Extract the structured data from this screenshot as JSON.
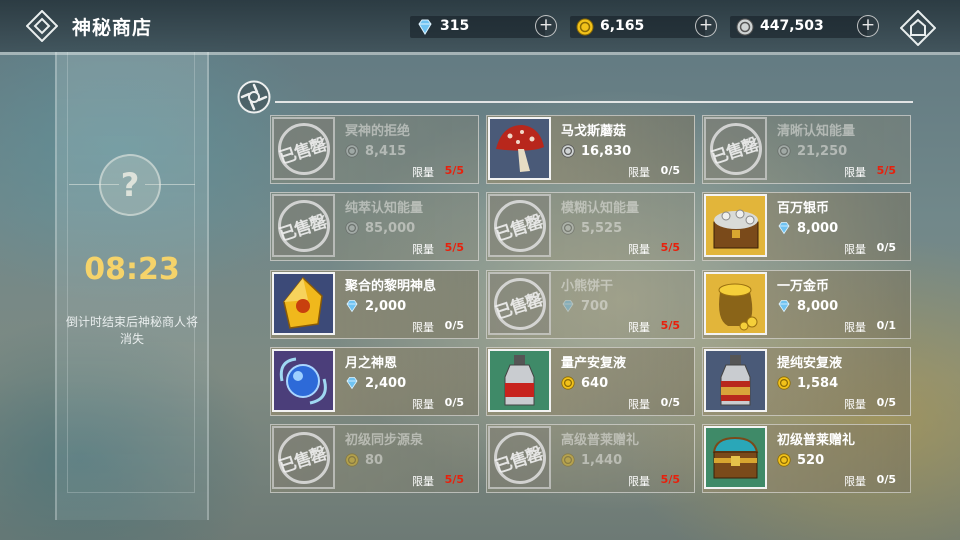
{
  "header": {
    "title": "神秘商店",
    "currencies": [
      {
        "icon": "diamond-icon",
        "value": "315"
      },
      {
        "icon": "gold-coin-icon",
        "value": "6,165"
      },
      {
        "icon": "silver-coin-icon",
        "value": "447,503"
      }
    ]
  },
  "merchant": {
    "timer": "08:23",
    "note": "倒计时结束后神秘商人将消失"
  },
  "limit_label": "限量",
  "sold_stamp": "已售罄",
  "colors": {
    "gold_text": "#f5d36a",
    "sold_limit": "#e8200c",
    "diamond": "#6fc3f2",
    "gold": "#f2c21a",
    "silver": "#cfd3d3"
  },
  "items": [
    {
      "name": "冥神的拒绝",
      "currency": "silver-coin-icon",
      "price": "8,415",
      "limit": "5/5",
      "sold": true,
      "image": "sold-out-stamp"
    },
    {
      "name": "马戈斯蘑菇",
      "currency": "silver-coin-icon",
      "price": "16,830",
      "limit": "0/5",
      "sold": false,
      "image": "mushroom-icon"
    },
    {
      "name": "清晰认知能量",
      "currency": "silver-coin-icon",
      "price": "21,250",
      "limit": "5/5",
      "sold": true,
      "image": "sold-out-stamp"
    },
    {
      "name": "纯萃认知能量",
      "currency": "silver-coin-icon",
      "price": "85,000",
      "limit": "5/5",
      "sold": true,
      "image": "sold-out-stamp"
    },
    {
      "name": "模糊认知能量",
      "currency": "silver-coin-icon",
      "price": "5,525",
      "limit": "5/5",
      "sold": true,
      "image": "sold-out-stamp"
    },
    {
      "name": "百万银币",
      "currency": "diamond-icon",
      "price": "8,000",
      "limit": "0/5",
      "sold": false,
      "image": "treasure-chest-coins-icon"
    },
    {
      "name": "聚合的黎明神息",
      "currency": "diamond-icon",
      "price": "2,000",
      "limit": "0/5",
      "sold": false,
      "image": "amber-crystal-icon"
    },
    {
      "name": "小熊饼干",
      "currency": "diamond-icon",
      "price": "700",
      "limit": "5/5",
      "sold": true,
      "image": "sold-out-stamp"
    },
    {
      "name": "一万金币",
      "currency": "diamond-icon",
      "price": "8,000",
      "limit": "0/1",
      "sold": false,
      "image": "gold-sack-icon"
    },
    {
      "name": "月之神恩",
      "currency": "diamond-icon",
      "price": "2,400",
      "limit": "0/5",
      "sold": false,
      "image": "blue-orb-icon"
    },
    {
      "name": "量产安复液",
      "currency": "gold-coin-icon",
      "price": "640",
      "limit": "0/5",
      "sold": false,
      "image": "potion-bottle-icon"
    },
    {
      "name": "提纯安复液",
      "currency": "gold-coin-icon",
      "price": "1,584",
      "limit": "0/5",
      "sold": false,
      "image": "ornate-potion-icon"
    },
    {
      "name": "初级同步源泉",
      "currency": "gold-coin-icon",
      "price": "80",
      "limit": "5/5",
      "sold": true,
      "image": "sold-out-stamp"
    },
    {
      "name": "高级普莱赠礼",
      "currency": "gold-coin-icon",
      "price": "1,440",
      "limit": "5/5",
      "sold": true,
      "image": "sold-out-stamp"
    },
    {
      "name": "初级普莱赠礼",
      "currency": "gold-coin-icon",
      "price": "520",
      "limit": "0/5",
      "sold": false,
      "image": "teal-chest-icon"
    }
  ]
}
